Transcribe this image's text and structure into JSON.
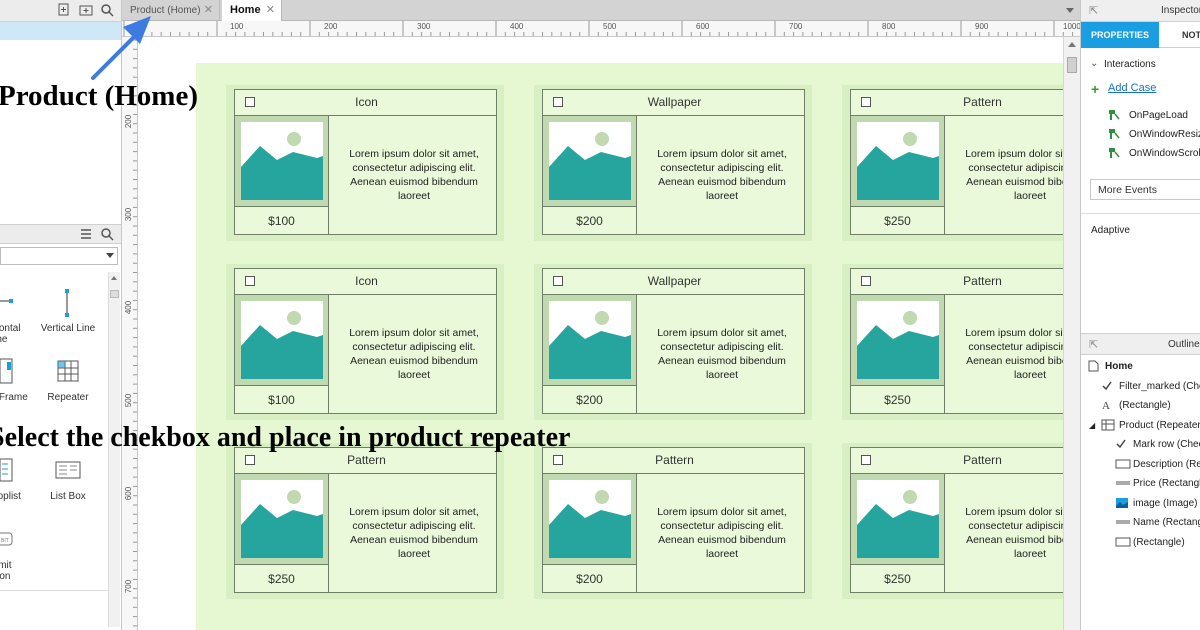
{
  "tabs": [
    {
      "label": "Product (Home)",
      "active": false
    },
    {
      "label": "Home",
      "active": true
    }
  ],
  "hruler_labels": [
    "100",
    "200",
    "300",
    "400",
    "500",
    "600",
    "700",
    "800",
    "900",
    "1000"
  ],
  "vruler_labels": [
    "200",
    "300",
    "400",
    "500",
    "600",
    "700"
  ],
  "widgets": [
    {
      "label": "Horizontal Line",
      "icon": "horizontal-line-icon"
    },
    {
      "label": "Vertical Line",
      "icon": "vertical-line-icon"
    },
    {
      "label": "Inline Frame",
      "icon": "inline-frame-icon"
    },
    {
      "label": "Repeater",
      "icon": "repeater-icon"
    },
    {
      "label": "Droplist",
      "icon": "droplist-icon"
    },
    {
      "label": "List Box",
      "icon": "list-box-icon"
    },
    {
      "label": "Submit Button",
      "icon": "submit-button-icon"
    }
  ],
  "card_description": "Lorem ipsum dolor sit amet, consectetur adipiscing elit. Aenean euismod bibendum laoreet",
  "cards": [
    {
      "title": "Icon",
      "price": "$100"
    },
    {
      "title": "Wallpaper",
      "price": "$200"
    },
    {
      "title": "Pattern",
      "price": "$250"
    },
    {
      "title": "Icon",
      "price": "$100"
    },
    {
      "title": "Wallpaper",
      "price": "$200"
    },
    {
      "title": "Pattern",
      "price": "$250"
    },
    {
      "title": "Pattern",
      "price": "$250"
    },
    {
      "title": "Pattern",
      "price": "$200"
    },
    {
      "title": "Pattern",
      "price": "$250"
    }
  ],
  "overlays": {
    "title": "Product (Home)",
    "instruction": "Select the chekbox and place in product repeater"
  },
  "inspector": {
    "header": "Inspector",
    "tabs": [
      "PROPERTIES",
      "NOTES"
    ],
    "interactions_label": "Interactions",
    "add_case": "Add Case",
    "events": [
      "OnPageLoad",
      "OnWindowResize",
      "OnWindowScroll"
    ],
    "more_events": "More Events",
    "adaptive": "Adaptive"
  },
  "outline": {
    "header": "Outline: Page",
    "items": [
      {
        "label": "Home",
        "icon": "page-icon",
        "level": 0
      },
      {
        "label": "Filter_marked (Checkbox)",
        "icon": "checkmark-icon",
        "level": 1
      },
      {
        "label": "(Rectangle)",
        "icon": "text-icon",
        "level": 1
      },
      {
        "label": "Product (Repeater)",
        "icon": "repeater-icon",
        "level": 1
      },
      {
        "label": "Mark row (Checkbox)",
        "icon": "checkmark-icon",
        "level": 2
      },
      {
        "label": "Description (Rectangle)",
        "icon": "rectangle-icon",
        "level": 2
      },
      {
        "label": "Price (Rectangle)",
        "icon": "line-icon",
        "level": 2
      },
      {
        "label": "image (Image)",
        "icon": "image-icon",
        "level": 2
      },
      {
        "label": "Name (Rectangle)",
        "icon": "line-icon",
        "level": 2
      },
      {
        "label": "(Rectangle)",
        "icon": "rectangle-icon",
        "level": 2
      }
    ]
  },
  "colors": {
    "accent": "#1a9de1",
    "card_bg": "#d8efc4",
    "canvas_bg": "#e6f8d2",
    "image_teal": "#26a49e",
    "arrow": "#3d7be0"
  }
}
